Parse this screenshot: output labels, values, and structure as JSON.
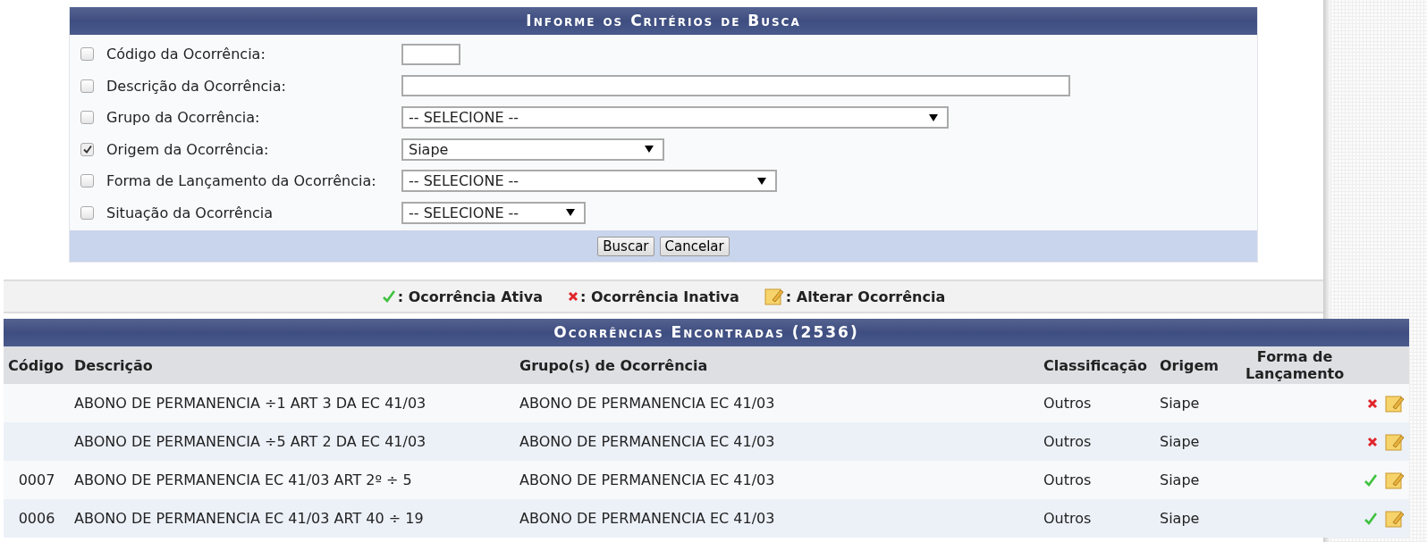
{
  "search_panel": {
    "title": "Informe os Critérios de Busca",
    "criteria": [
      {
        "label": "Código da Ocorrência:",
        "checked": false,
        "kind": "text"
      },
      {
        "label": "Descrição da Ocorrência:",
        "checked": false,
        "kind": "text"
      },
      {
        "label": "Grupo da Ocorrência:",
        "checked": false,
        "kind": "select",
        "value": "-- SELECIONE --"
      },
      {
        "label": "Origem da Ocorrência:",
        "checked": true,
        "kind": "select",
        "value": "Siape"
      },
      {
        "label": "Forma de Lançamento da Ocorrência:",
        "checked": false,
        "kind": "select",
        "value": "-- SELECIONE --"
      },
      {
        "label": "Situação da Ocorrência",
        "checked": false,
        "kind": "select",
        "value": "-- SELECIONE --"
      }
    ],
    "buttons": [
      "Buscar",
      "Cancelar"
    ]
  },
  "legend": [
    {
      "kind": "active",
      "label": ": Ocorrência Ativa"
    },
    {
      "kind": "inactive",
      "label": ": Ocorrência Inativa"
    },
    {
      "kind": "edit",
      "label": ": Alterar Ocorrência"
    }
  ],
  "results": {
    "title": "Ocorrências Encontradas (2536)",
    "columns": [
      "Código",
      "Descrição",
      "Grupo(s) de Ocorrência",
      "Classificação",
      "Origem",
      "Forma de Lançamento"
    ],
    "rows": [
      {
        "codigo": "",
        "descricao": "ABONO DE PERMANENCIA ÷1 ART 3 DA EC 41/03",
        "grupo": "ABONO DE PERMANENCIA EC 41/03",
        "classificacao": "Outros",
        "origem": "Siape",
        "active": false
      },
      {
        "codigo": "",
        "descricao": "ABONO DE PERMANENCIA ÷5 ART 2 DA EC 41/03",
        "grupo": "ABONO DE PERMANENCIA EC 41/03",
        "classificacao": "Outros",
        "origem": "Siape",
        "active": false
      },
      {
        "codigo": "0007",
        "descricao": "ABONO DE PERMANENCIA EC 41/03 ART 2º ÷ 5",
        "grupo": "ABONO DE PERMANENCIA EC 41/03",
        "classificacao": "Outros",
        "origem": "Siape",
        "active": true
      },
      {
        "codigo": "0006",
        "descricao": "ABONO DE PERMANENCIA EC 41/03 ART 40 ÷ 19",
        "grupo": "ABONO DE PERMANENCIA EC 41/03",
        "classificacao": "Outros",
        "origem": "Siape",
        "active": true
      }
    ]
  }
}
